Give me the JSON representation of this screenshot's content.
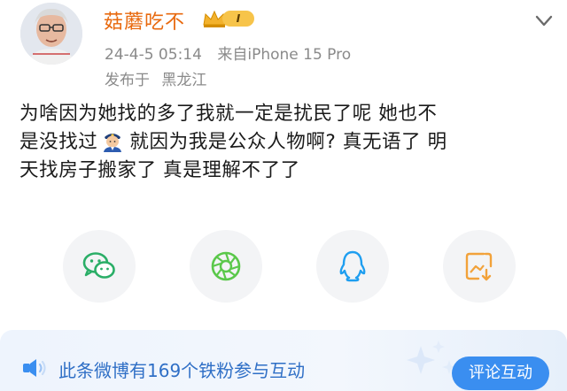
{
  "user": {
    "name": "菇蘑吃不",
    "level_badge": "I"
  },
  "post_meta": {
    "date": "24-4-5 05:14",
    "source": "来自iPhone 15 Pro",
    "location_label": "发布于",
    "location": "黑龙江"
  },
  "post": {
    "line1": "为啥因为她找的多了我就一定是扰民了呢 她也不",
    "line2_pre": "是没找过",
    "line2_post": "就因为我是公众人物啊? 真无语了 明",
    "line3": "天找房子搬家了 真是理解不了了",
    "inline_icon": "police-officer-emoji"
  },
  "share_actions": [
    {
      "icon": "wechat-icon"
    },
    {
      "icon": "moments-icon"
    },
    {
      "icon": "qq-icon"
    },
    {
      "icon": "save-image-icon"
    }
  ],
  "banner": {
    "text": "此条微博有169个铁粉参与互动",
    "button_label": "评论互动"
  },
  "colors": {
    "username": "#e8690e",
    "meta": "#8a8a8a",
    "banner_text": "#2f6fc6",
    "button": "#3a8ef0",
    "wechat": "#2aae67",
    "moments": "#5ac84a",
    "qq": "#1e9ef0",
    "save": "#f2a23a"
  }
}
